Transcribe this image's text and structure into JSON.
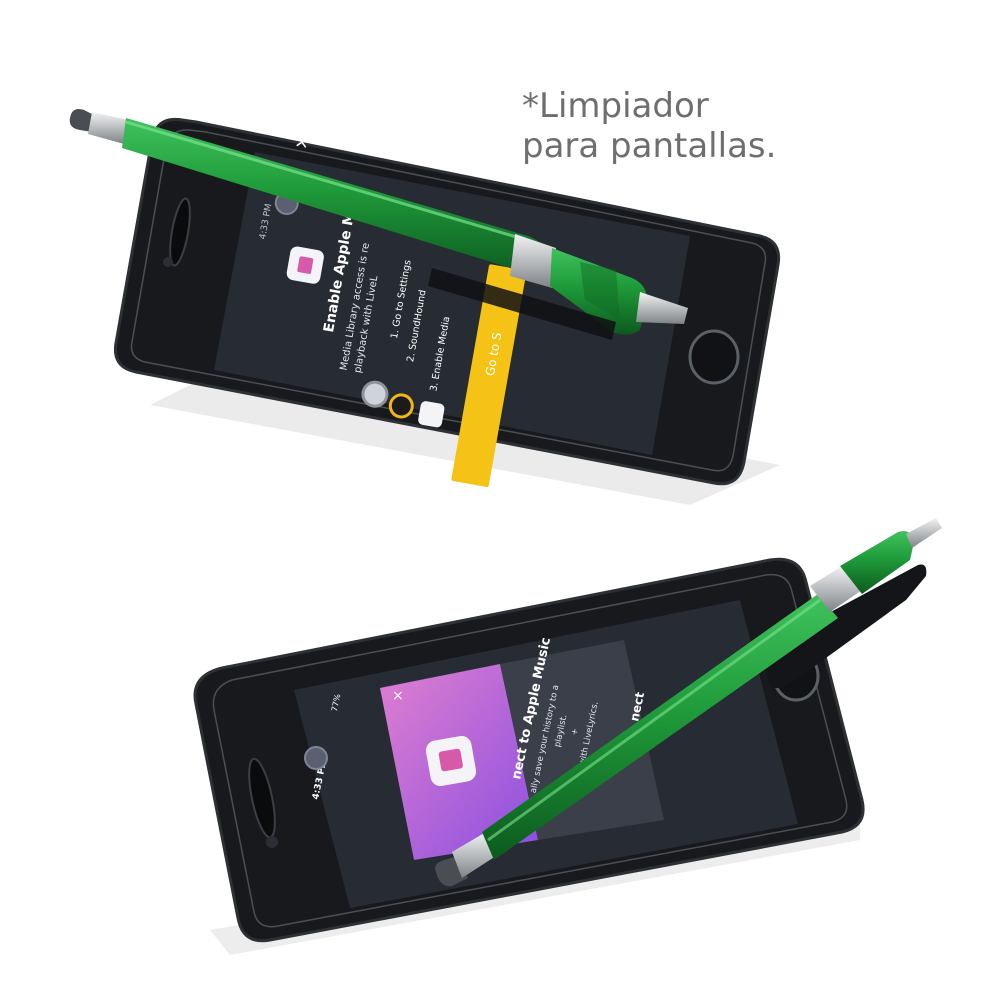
{
  "caption": {
    "line1": "*Limpiador",
    "line2": "para pantallas."
  },
  "phone_top": {
    "time": "4:33 PM",
    "close_glyph": "×",
    "title": "Enable Apple Mu",
    "body_line1": "Media Library access is re",
    "body_line2": "playback with LiveL",
    "step1": "1. Go to Settings",
    "step2": "2. SoundHound",
    "step3": "3. Enable Media",
    "cta": "Go to S"
  },
  "phone_bottom": {
    "time": "4:33 PM",
    "battery": "77%",
    "close_glyph": "×",
    "title": "nect to Apple Music",
    "body_line1": "ally save your history to a",
    "body_line2": "playlist.",
    "body_line3": "+",
    "body_line4": "songs with LiveLyrics.",
    "side_title": "nect"
  },
  "colors": {
    "pen_green": "#1f9a3a",
    "pen_green_dark": "#0f6b24",
    "phone_black": "#15171a",
    "screen_dark": "#262b34",
    "cta_yellow": "#f5c316",
    "card_purple": "#c35ad6"
  }
}
